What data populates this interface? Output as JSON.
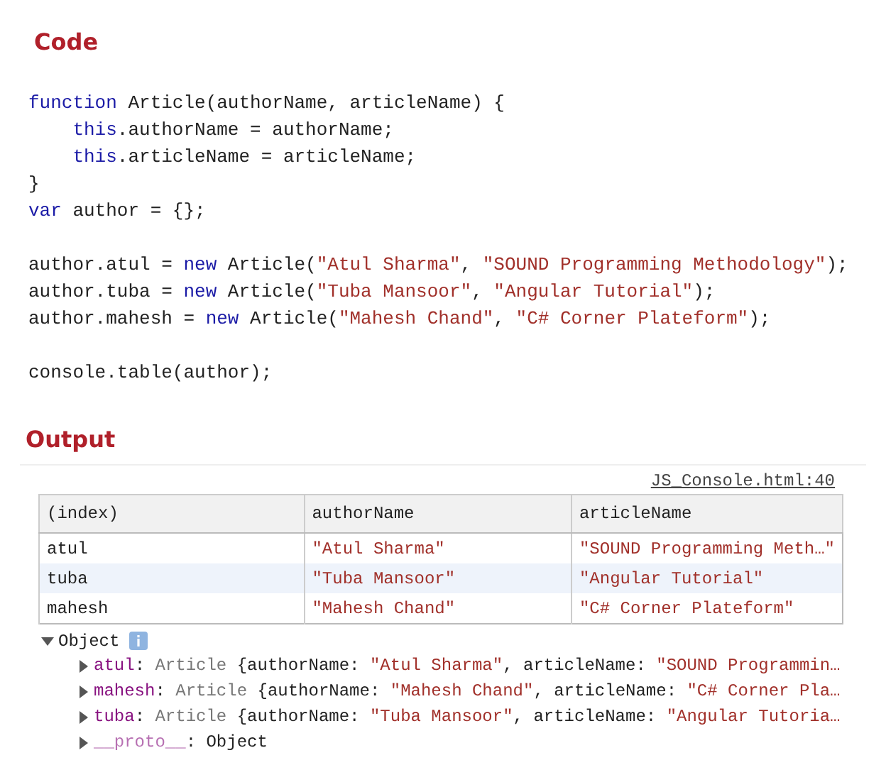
{
  "code_section": {
    "heading": "Code",
    "blocks": [
      [
        [
          {
            "kind": "keyword",
            "text": "function"
          },
          {
            "kind": "plain",
            "text": " Article(authorName, articleName) {"
          }
        ],
        [
          {
            "kind": "keyword",
            "text": "    this"
          },
          {
            "kind": "plain",
            "text": ".authorName = authorName;"
          }
        ],
        [
          {
            "kind": "keyword",
            "text": "    this"
          },
          {
            "kind": "plain",
            "text": ".articleName = articleName;"
          }
        ],
        [
          {
            "kind": "plain",
            "text": "}"
          }
        ],
        [
          {
            "kind": "keyword",
            "text": "var"
          },
          {
            "kind": "plain",
            "text": " author = {};"
          }
        ]
      ],
      [
        [
          {
            "kind": "plain",
            "text": "author.atul = "
          },
          {
            "kind": "keyword",
            "text": "new"
          },
          {
            "kind": "plain",
            "text": " Article("
          },
          {
            "kind": "string",
            "text": "\"Atul Sharma\""
          },
          {
            "kind": "plain",
            "text": ", "
          },
          {
            "kind": "string",
            "text": "\"SOUND Programming Methodology\""
          },
          {
            "kind": "plain",
            "text": ");"
          }
        ],
        [
          {
            "kind": "plain",
            "text": "author.tuba = "
          },
          {
            "kind": "keyword",
            "text": "new"
          },
          {
            "kind": "plain",
            "text": " Article("
          },
          {
            "kind": "string",
            "text": "\"Tuba Mansoor\""
          },
          {
            "kind": "plain",
            "text": ", "
          },
          {
            "kind": "string",
            "text": "\"Angular Tutorial\""
          },
          {
            "kind": "plain",
            "text": ");"
          }
        ],
        [
          {
            "kind": "plain",
            "text": "author.mahesh = "
          },
          {
            "kind": "keyword",
            "text": "new"
          },
          {
            "kind": "plain",
            "text": " Article("
          },
          {
            "kind": "string",
            "text": "\"Mahesh Chand\""
          },
          {
            "kind": "plain",
            "text": ", "
          },
          {
            "kind": "string",
            "text": "\"C# Corner Plateform\""
          },
          {
            "kind": "plain",
            "text": ");"
          }
        ]
      ],
      [
        [
          {
            "kind": "plain",
            "text": "console.table(author);"
          }
        ]
      ]
    ]
  },
  "output_section": {
    "heading": "Output",
    "source_link": "JS_Console.html:40",
    "table": {
      "columns": [
        "(index)",
        "authorName",
        "articleName"
      ],
      "rows": [
        [
          "atul",
          "\"Atul Sharma\"",
          "\"SOUND Programming Meth…\""
        ],
        [
          "tuba",
          "\"Tuba Mansoor\"",
          "\"Angular Tutorial\""
        ],
        [
          "mahesh",
          "\"Mahesh Chand\"",
          "\"C# Corner Plateform\""
        ]
      ]
    },
    "object": {
      "label": "Object",
      "expanded": true,
      "children": [
        {
          "expanded": false,
          "tokens": [
            {
              "kind": "key",
              "text": "atul"
            },
            {
              "kind": "plain",
              "text": ": "
            },
            {
              "kind": "class",
              "text": "Article"
            },
            {
              "kind": "plain",
              "text": " {authorName: "
            },
            {
              "kind": "string",
              "text": "\"Atul Sharma\""
            },
            {
              "kind": "plain",
              "text": ", articleName: "
            },
            {
              "kind": "string",
              "text": "\"SOUND Programmin…"
            }
          ]
        },
        {
          "expanded": false,
          "tokens": [
            {
              "kind": "key",
              "text": "mahesh"
            },
            {
              "kind": "plain",
              "text": ": "
            },
            {
              "kind": "class",
              "text": "Article"
            },
            {
              "kind": "plain",
              "text": " {authorName: "
            },
            {
              "kind": "string",
              "text": "\"Mahesh Chand\""
            },
            {
              "kind": "plain",
              "text": ", articleName: "
            },
            {
              "kind": "string",
              "text": "\"C# Corner Pla…"
            }
          ]
        },
        {
          "expanded": false,
          "tokens": [
            {
              "kind": "key",
              "text": "tuba"
            },
            {
              "kind": "plain",
              "text": ": "
            },
            {
              "kind": "class",
              "text": "Article"
            },
            {
              "kind": "plain",
              "text": " {authorName: "
            },
            {
              "kind": "string",
              "text": "\"Tuba Mansoor\""
            },
            {
              "kind": "plain",
              "text": ", articleName: "
            },
            {
              "kind": "string",
              "text": "\"Angular Tutoria…"
            }
          ]
        },
        {
          "expanded": false,
          "tokens": [
            {
              "kind": "proto",
              "text": "__proto__"
            },
            {
              "kind": "plain",
              "text": ": Object"
            }
          ]
        }
      ]
    }
  }
}
